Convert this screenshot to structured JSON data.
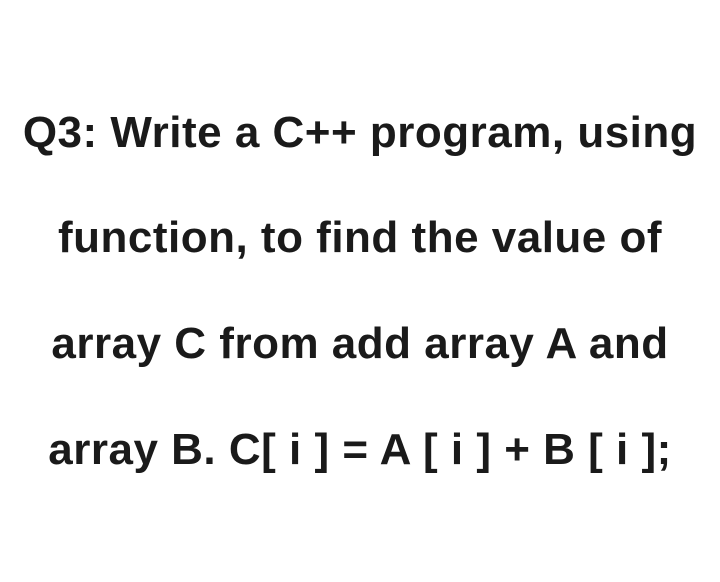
{
  "question": {
    "text": "Q3: Write a C++ program, using function, to find the value of array C from add array A and array B. C[ i ] = A [ i ] + B [ i ];"
  }
}
